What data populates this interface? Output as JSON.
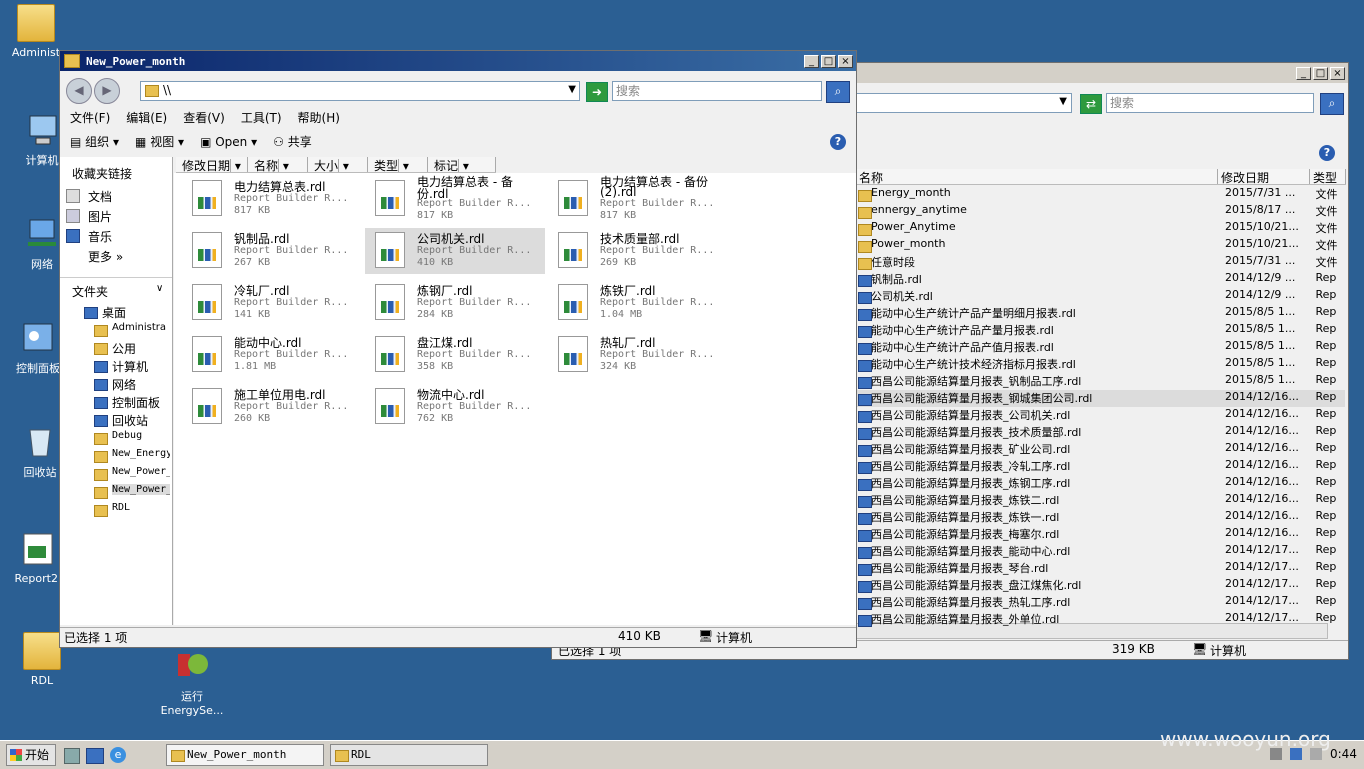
{
  "desktop": {
    "icons": [
      {
        "label": "Administ",
        "icon": "user-folder-icon"
      },
      {
        "label": "计算机",
        "icon": "computer-icon"
      },
      {
        "label": "网络",
        "icon": "network-icon"
      },
      {
        "label": "控制面板",
        "icon": "control-panel-icon"
      },
      {
        "label": "回收站",
        "icon": "recycle-bin-icon"
      },
      {
        "label": "Report2.",
        "icon": "report-shortcut-icon"
      },
      {
        "label": "RDL",
        "icon": "folder-icon"
      },
      {
        "label": "运行",
        "label2": "EnergySe...",
        "icon": "run-shortcut-icon"
      }
    ]
  },
  "front_window": {
    "title": "New_Power_month",
    "address": "\\\\",
    "search_placeholder": "搜索",
    "menu": [
      "文件(F)",
      "编辑(E)",
      "查看(V)",
      "工具(T)",
      "帮助(H)"
    ],
    "toolbar": {
      "organize": "组织",
      "views": "视图",
      "open": "Open",
      "share": "共享"
    },
    "columns": [
      "修改日期",
      "名称",
      "大小",
      "类型",
      "标记"
    ],
    "favorites_title": "收藏夹链接",
    "favorites": [
      "文档",
      "图片",
      "音乐",
      "更多"
    ],
    "folders_title": "文件夹",
    "tree": [
      "桌面",
      "Administra",
      "公用",
      "计算机",
      "网络",
      "控制面板",
      "回收站",
      "Debug",
      "New_Energy",
      "New_Power_",
      "New_Power_",
      "RDL"
    ],
    "files": [
      {
        "name": "电力结算总表.rdl",
        "type": "Report Builder R...",
        "size": "817 KB"
      },
      {
        "name": "电力结算总表 - 备",
        "name2": "份.rdl",
        "type": "Report Builder R...",
        "size": "817 KB"
      },
      {
        "name": "电力结算总表 - 备份",
        "name2": "(2).rdl",
        "type": "Report Builder R...",
        "size": "817 KB"
      },
      {
        "name": "钒制品.rdl",
        "type": "Report Builder R...",
        "size": "267 KB"
      },
      {
        "name": "公司机关.rdl",
        "type": "Report Builder R...",
        "size": "410 KB",
        "selected": true
      },
      {
        "name": "技术质量部.rdl",
        "type": "Report Builder R...",
        "size": "269 KB"
      },
      {
        "name": "冷轧厂.rdl",
        "type": "Report Builder R...",
        "size": "141 KB"
      },
      {
        "name": "炼钢厂.rdl",
        "type": "Report Builder R...",
        "size": "284 KB"
      },
      {
        "name": "炼铁厂.rdl",
        "type": "Report Builder R...",
        "size": "1.04 MB"
      },
      {
        "name": "能动中心.rdl",
        "type": "Report Builder R...",
        "size": "1.81 MB"
      },
      {
        "name": "盘江煤.rdl",
        "type": "Report Builder R...",
        "size": "358 KB"
      },
      {
        "name": "热轧厂.rdl",
        "type": "Report Builder R...",
        "size": "324 KB"
      },
      {
        "name": "施工单位用电.rdl",
        "type": "Report Builder R...",
        "size": "260 KB"
      },
      {
        "name": "物流中心.rdl",
        "type": "Report Builder R...",
        "size": "762 KB"
      }
    ],
    "status_selected": "已选择 1 项",
    "status_size": "410 KB",
    "status_location": "计算机"
  },
  "back_window": {
    "search_placeholder": "搜索",
    "columns": [
      "名称",
      "修改日期",
      "类型"
    ],
    "rows": [
      {
        "name": "Energy_month",
        "date": "2015/7/31 ...",
        "type": "文件"
      },
      {
        "name": "ennergy_anytime",
        "date": "2015/8/17 ...",
        "type": "文件"
      },
      {
        "name": "Power_Anytime",
        "date": "2015/10/21...",
        "type": "文件"
      },
      {
        "name": "Power_month",
        "date": "2015/10/21...",
        "type": "文件"
      },
      {
        "name": "任意时段",
        "date": "2015/7/31 ...",
        "type": "文件"
      },
      {
        "name": "钒制品.rdl",
        "date": "2014/12/9 ...",
        "type": "Rep"
      },
      {
        "name": "公司机关.rdl",
        "date": "2014/12/9 ...",
        "type": "Rep"
      },
      {
        "name": "能动中心生产统计产品产量明细月报表.rdl",
        "date": "2015/8/5 1...",
        "type": "Rep"
      },
      {
        "name": "能动中心生产统计产品产量月报表.rdl",
        "date": "2015/8/5 1...",
        "type": "Rep"
      },
      {
        "name": "能动中心生产统计产品产值月报表.rdl",
        "date": "2015/8/5 1...",
        "type": "Rep"
      },
      {
        "name": "能动中心生产统计技术经济指标月报表.rdl",
        "date": "2015/8/5 1...",
        "type": "Rep"
      },
      {
        "name": "西昌公司能源结算量月报表_钒制品工序.rdl",
        "date": "2015/8/5 1...",
        "type": "Rep"
      },
      {
        "name": "西昌公司能源结算量月报表_钢城集团公司.rdl",
        "date": "2014/12/16...",
        "type": "Rep",
        "selected": true
      },
      {
        "name": "西昌公司能源结算量月报表_公司机关.rdl",
        "date": "2014/12/16...",
        "type": "Rep"
      },
      {
        "name": "西昌公司能源结算量月报表_技术质量部.rdl",
        "date": "2014/12/16...",
        "type": "Rep"
      },
      {
        "name": "西昌公司能源结算量月报表_矿业公司.rdl",
        "date": "2014/12/16...",
        "type": "Rep"
      },
      {
        "name": "西昌公司能源结算量月报表_冷轧工序.rdl",
        "date": "2014/12/16...",
        "type": "Rep"
      },
      {
        "name": "西昌公司能源结算量月报表_炼钢工序.rdl",
        "date": "2014/12/16...",
        "type": "Rep"
      },
      {
        "name": "西昌公司能源结算量月报表_炼铁二.rdl",
        "date": "2014/12/16...",
        "type": "Rep"
      },
      {
        "name": "西昌公司能源结算量月报表_炼铁一.rdl",
        "date": "2014/12/16...",
        "type": "Rep"
      },
      {
        "name": "西昌公司能源结算量月报表_梅塞尔.rdl",
        "date": "2014/12/16...",
        "type": "Rep"
      },
      {
        "name": "西昌公司能源结算量月报表_能动中心.rdl",
        "date": "2014/12/17...",
        "type": "Rep"
      },
      {
        "name": "西昌公司能源结算量月报表_琴台.rdl",
        "date": "2014/12/17...",
        "type": "Rep"
      },
      {
        "name": "西昌公司能源结算量月报表_盘江煤焦化.rdl",
        "date": "2014/12/17...",
        "type": "Rep"
      },
      {
        "name": "西昌公司能源结算量月报表_热轧工序.rdl",
        "date": "2014/12/17...",
        "type": "Rep"
      },
      {
        "name": "西昌公司能源结算量月报表_外单位.rdl",
        "date": "2014/12/17...",
        "type": "Rep"
      }
    ],
    "status_selected": "已选择 1 项",
    "status_size": "319 KB",
    "status_location": "计算机"
  },
  "taskbar": {
    "start": "开始",
    "items": [
      "New_Power_month",
      "RDL"
    ],
    "clock": "0:44",
    "watermark": "www.wooyun.org"
  }
}
